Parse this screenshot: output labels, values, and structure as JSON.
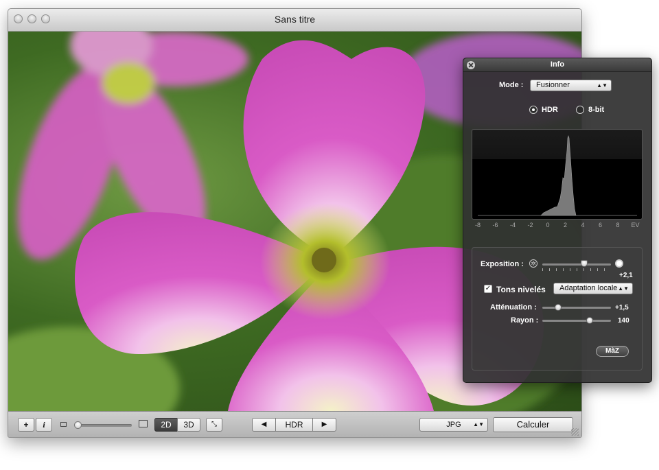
{
  "window": {
    "title": "Sans titre"
  },
  "toolbar": {
    "add_label": "+",
    "info_label": "i",
    "mode_2d": "2D",
    "mode_3d": "3D",
    "prev_label": "◀",
    "hdr_label": "HDR",
    "next_label": "▶",
    "format_value": "JPG",
    "compute_label": "Calculer"
  },
  "info_panel": {
    "title": "Info",
    "mode_label": "Mode :",
    "mode_value": "Fusionner",
    "radio_hdr": "HDR",
    "radio_8bit": "8-bit",
    "histogram_ticks": [
      "-8",
      "-6",
      "-4",
      "-2",
      "0",
      "2",
      "4",
      "6",
      "8",
      "EV"
    ],
    "exposure_label": "Exposition :",
    "exposure_value": "+2,1",
    "tonemap_label": "Tons nivelés",
    "tonemap_checked": true,
    "tonemap_method": "Adaptation locale",
    "attenuation_label": "Atténuation :",
    "attenuation_value": "+1,5",
    "radius_label": "Rayon :",
    "radius_value": "140",
    "reset_label": "MàZ"
  },
  "colors": {
    "petal": "#d54bc1",
    "petal_light": "#f2b6ea",
    "center": "#b9c23a",
    "panel": "#303030"
  }
}
